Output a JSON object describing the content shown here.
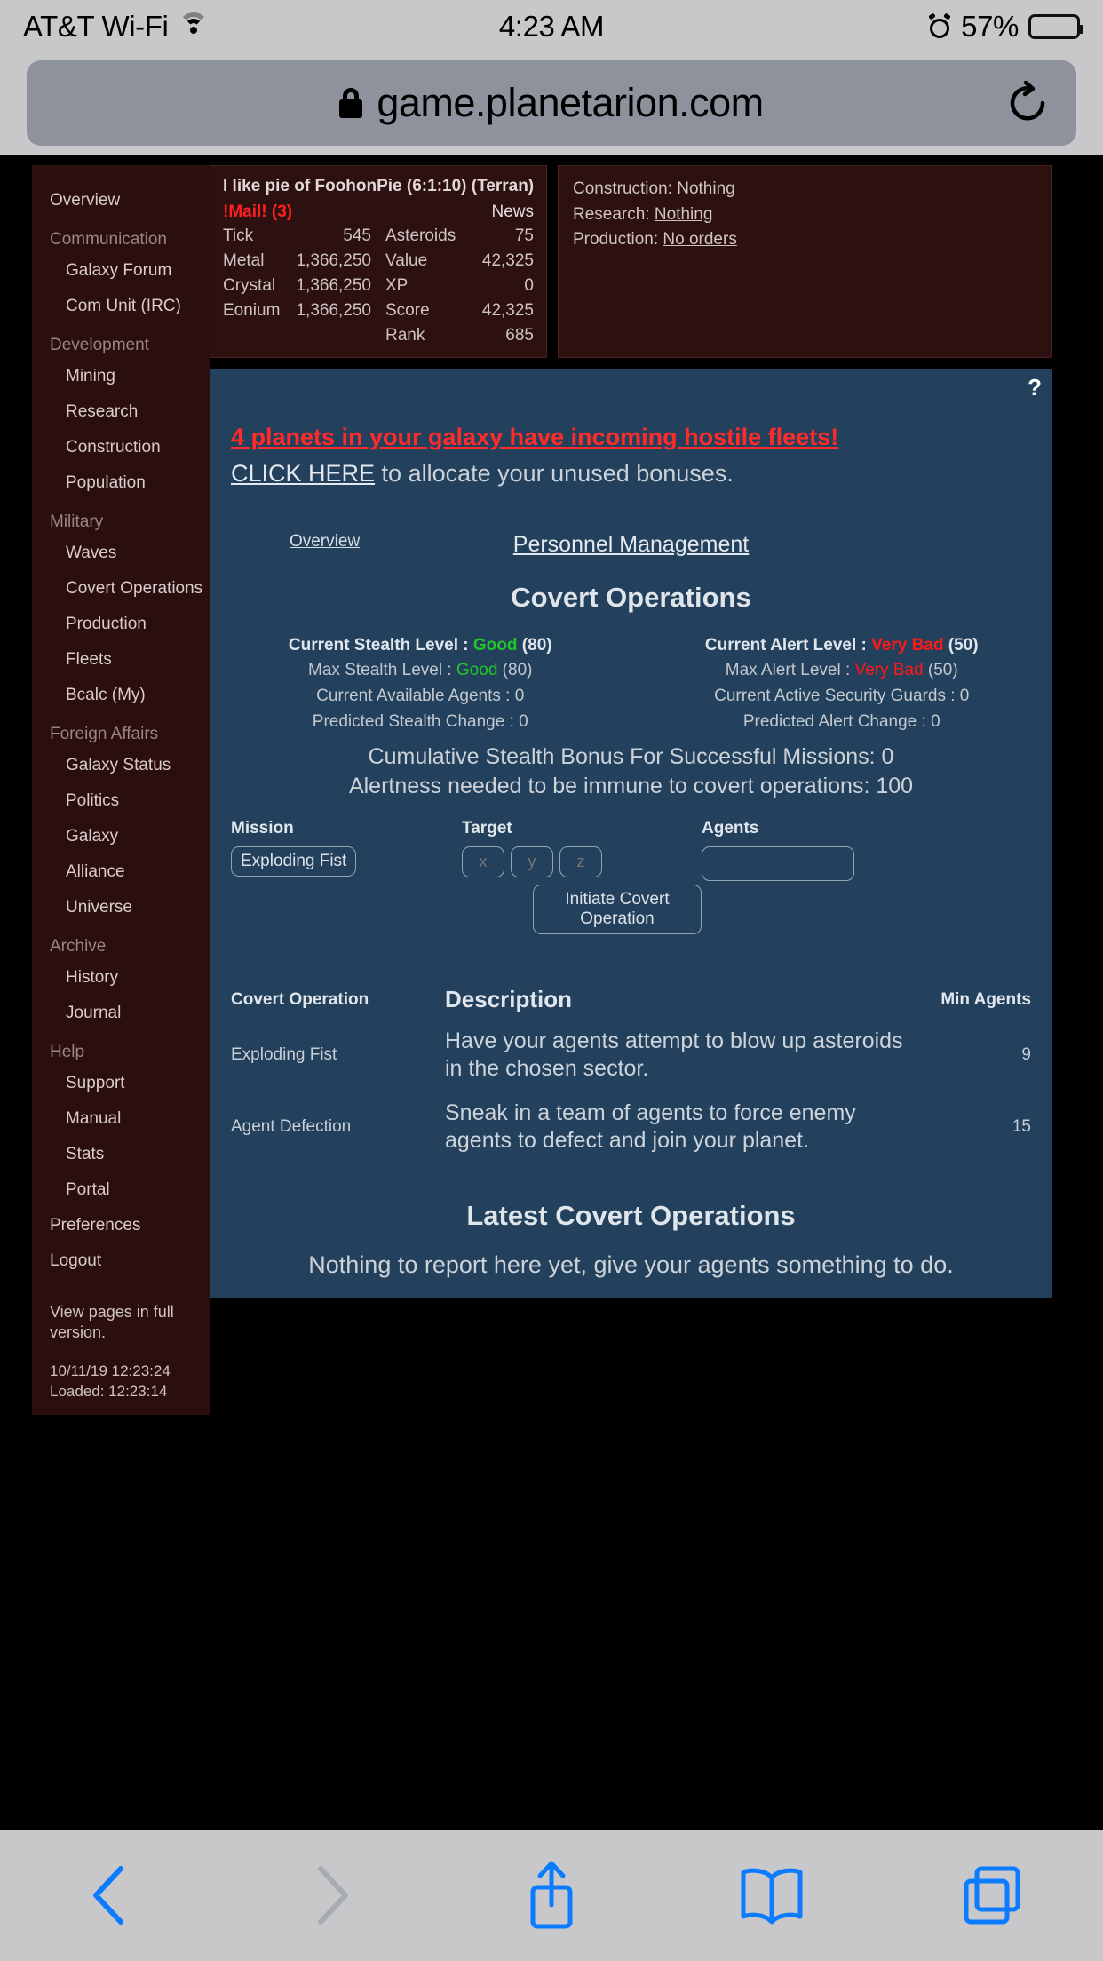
{
  "statusbar": {
    "carrier": "AT&T Wi-Fi",
    "wifi_icon": "wifi-icon",
    "time": "4:23 AM",
    "alarm_icon": "alarm-icon",
    "battery_percent": "57%",
    "battery_icon": "battery-icon"
  },
  "browser": {
    "lock_icon": "lock-icon",
    "url": "game.planetarion.com",
    "reload_icon": "reload-icon",
    "back_icon": "back-chevron-icon",
    "forward_icon": "forward-chevron-icon",
    "share_icon": "share-icon",
    "bookmarks_icon": "book-icon",
    "tabs_icon": "tabs-icon"
  },
  "sidebar": {
    "items": [
      {
        "label": "Overview",
        "type": "link-top"
      },
      {
        "label": "Communication",
        "type": "group"
      },
      {
        "label": "Galaxy Forum",
        "type": "link"
      },
      {
        "label": "Com Unit (IRC)",
        "type": "link"
      },
      {
        "label": "Development",
        "type": "group"
      },
      {
        "label": "Mining",
        "type": "link"
      },
      {
        "label": "Research",
        "type": "link"
      },
      {
        "label": "Construction",
        "type": "link"
      },
      {
        "label": "Population",
        "type": "link"
      },
      {
        "label": "Military",
        "type": "group"
      },
      {
        "label": "Waves",
        "type": "link"
      },
      {
        "label": "Covert Operations",
        "type": "link"
      },
      {
        "label": "Production",
        "type": "link"
      },
      {
        "label": "Fleets",
        "type": "link"
      },
      {
        "label": "Bcalc (My)",
        "type": "link"
      },
      {
        "label": "Foreign Affairs",
        "type": "group"
      },
      {
        "label": "Galaxy Status",
        "type": "link"
      },
      {
        "label": "Politics",
        "type": "link"
      },
      {
        "label": "Galaxy",
        "type": "link"
      },
      {
        "label": "Alliance",
        "type": "link"
      },
      {
        "label": "Universe",
        "type": "link"
      },
      {
        "label": "Archive",
        "type": "group"
      },
      {
        "label": "History",
        "type": "link"
      },
      {
        "label": "Journal",
        "type": "link"
      },
      {
        "label": "Help",
        "type": "group"
      },
      {
        "label": "Support",
        "type": "link"
      },
      {
        "label": "Manual",
        "type": "link"
      },
      {
        "label": "Stats",
        "type": "link"
      },
      {
        "label": "Portal",
        "type": "link"
      },
      {
        "label": "Preferences",
        "type": "link-top"
      },
      {
        "label": "Logout",
        "type": "link-top"
      }
    ],
    "footer": {
      "full_version": "View pages in full version.",
      "timestamp": "10/11/19 12:23:24",
      "loaded": "Loaded: 12:23:14"
    }
  },
  "stats_panel": {
    "title": "I like pie of FoohonPie (6:1:10) (Terran)",
    "mail_label": "!Mail! (3)",
    "news_label": "News",
    "left_rows": [
      {
        "k": "Tick",
        "v": "545"
      },
      {
        "k": "Metal",
        "v": "1,366,250"
      },
      {
        "k": "Crystal",
        "v": "1,366,250"
      },
      {
        "k": "Eonium",
        "v": "1,366,250"
      }
    ],
    "right_rows": [
      {
        "k": "Asteroids",
        "v": "75"
      },
      {
        "k": "Value",
        "v": "42,325"
      },
      {
        "k": "XP",
        "v": "0"
      },
      {
        "k": "Score",
        "v": "42,325"
      },
      {
        "k": "Rank",
        "v": "685"
      }
    ]
  },
  "orders_panel": {
    "construction_label": "Construction:",
    "construction_value": "Nothing",
    "research_label": "Research:",
    "research_value": "Nothing",
    "production_label": "Production:",
    "production_value": "No orders"
  },
  "main": {
    "help_icon": "?",
    "alert_red": "4 planets in your galaxy have incoming hostile fleets!",
    "alert_click_here": "CLICK HERE",
    "alert_rest": " to allocate your unused bonuses.",
    "link_overview": "Overview",
    "link_personnel": "Personnel Management",
    "title": "Covert Operations",
    "stealth": {
      "current_label": "Current Stealth Level : ",
      "current_value": "Good",
      "current_number": " (80)",
      "max_label": "Max Stealth Level : ",
      "max_value": "Good",
      "max_number": " (80)",
      "agents": "Current Available Agents : 0",
      "predicted": "Predicted Stealth Change : 0"
    },
    "alert_level": {
      "current_label": "Current Alert Level : ",
      "current_value": "Very Bad",
      "current_number": " (50)",
      "max_label": "Max Alert Level : ",
      "max_value": "Very Bad",
      "max_number": " (50)",
      "guards": "Current Active Security Guards : 0",
      "predicted": "Predicted Alert Change : 0"
    },
    "cumulative": "Cumulative Stealth Bonus For Successful Missions: 0",
    "alertness": "Alertness needed to be immune to covert operations: 100",
    "form": {
      "mission_label": "Mission",
      "mission_value": "Exploding Fist",
      "target_label": "Target",
      "target_x_placeholder": "x",
      "target_y_placeholder": "y",
      "target_z_placeholder": "z",
      "target_x_value": "",
      "target_y_value": "",
      "target_z_value": "",
      "agents_label": "Agents",
      "agents_value": "",
      "submit_label": "Initiate Covert Operation"
    },
    "table": {
      "headers": [
        "Covert Operation",
        "Description",
        "Min Agents"
      ],
      "rows": [
        {
          "op": "Exploding Fist",
          "desc": "Have your agents attempt to blow up asteroids in the chosen sector.",
          "min": "9"
        },
        {
          "op": "Agent Defection",
          "desc": "Sneak in a team of agents to force enemy agents to defect and join your planet.",
          "min": "15"
        }
      ]
    },
    "latest_title": "Latest Covert Operations",
    "latest_empty": "Nothing to report here yet, give your agents something to do."
  },
  "colors": {
    "sidebar_bg": "#2b0e0e",
    "panel_bg": "#2d1010",
    "main_bg": "#23405c",
    "alert_red": "#ff2b2b",
    "good_green": "#22c527",
    "bad_red": "#ff1818",
    "ios_chrome": "#c8c8cb",
    "toolbar_blue": "#0b7bff"
  }
}
